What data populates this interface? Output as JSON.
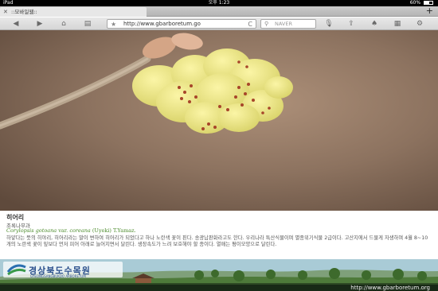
{
  "status": {
    "device": "iPad",
    "time": "오후 1:23",
    "battery": "60%"
  },
  "tab": {
    "title": "::모바일웹::"
  },
  "toolbar": {
    "url": "http://www.gbarboretum.go",
    "search_placeholder": "NAVER"
  },
  "plant": {
    "name": "히어리",
    "family": "조록나무과",
    "sci_italic": "Corylopsis gotoana",
    "sci_var": " var. ",
    "sci_var_name": "coreana",
    "sci_author": " (Uyeki) T.Yamaz.",
    "description": "하얗다는 뜻의 히야리, 히어리라는 말이 변하여 히어리가 되었다고 하나 노란색 꽃이 핀다. 송광납판화라고도 한다. 우리나라 특산식물이며 멸종위기식물 2급이다. 고산지에서 드물게 자생하며 4월 8~10개의 노란색 꽃이 잎보다 먼저 피어 아래로 늘어지면서 달린다. 생장속도가 느려 보호해야 할 종이다. 열매는 평이모양으로 달린다."
  },
  "banner": {
    "logo_text": "경상북도수목원",
    "logo_sub": "GYEONGSANGBUKDO ARBORETUM",
    "url": "http://www.gbarboretum.org"
  }
}
